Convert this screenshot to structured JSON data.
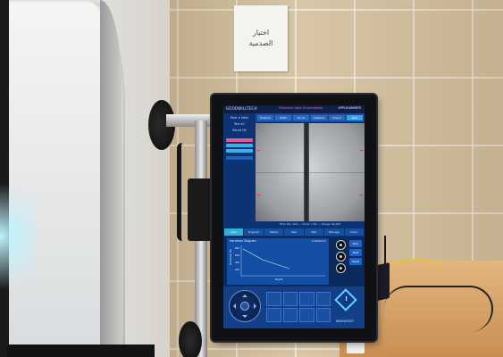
{
  "scene": {
    "sign": {
      "line1": "اختيار",
      "line2": "الصدمية"
    }
  },
  "monitor": {
    "header": {
      "logo": "GOODWILLTECH",
      "status": "Standard  data  (Automated)",
      "brand": "APPLIKAMMER"
    },
    "sidebar": {
      "lines": [
        "Fiber A Stats",
        "Test #1",
        "Result OK"
      ]
    },
    "tabs": [
      "Position",
      "Stats",
      "Focus",
      "Capture",
      "Check",
      "Rels"
    ],
    "active_tab_index": 5,
    "live_caption": "Fiber Pos: 120 ---- Score: 1.56  ---- Range: 90-105",
    "mid_tabs": [
      "Auto",
      "Program",
      "Status",
      "Test",
      "Stat",
      "Manage",
      "Done"
    ],
    "mid_active_index": 0,
    "graph": {
      "title": "Hardness Diagram",
      "right_label": "0.1000mm",
      "y_label": "Hardness HV",
      "ticks": [
        "800",
        "600",
        "400",
        "200"
      ],
      "x_label": "Depth"
    },
    "right_buttons": [
      "Prev",
      "Next",
      "Reset"
    ],
    "bottom_brand": "INNOVATEST"
  },
  "colors": {
    "screen_bg": "#0b2a5e",
    "tab_active": "#3aa2e8",
    "accent": "#2fb0d6"
  }
}
